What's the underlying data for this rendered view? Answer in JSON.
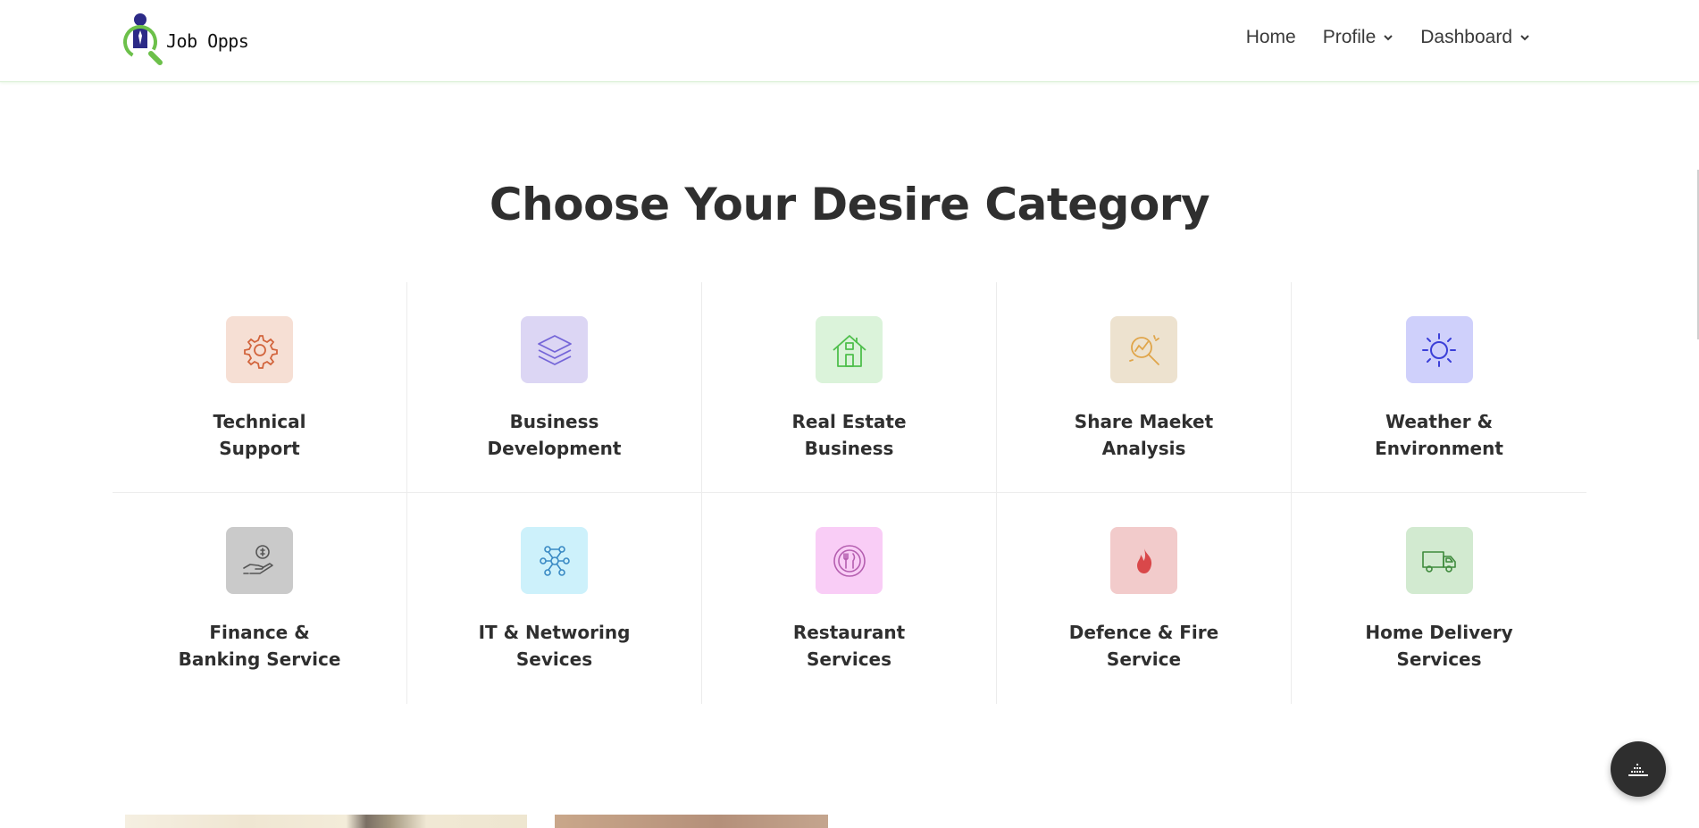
{
  "brand": {
    "name": "Job Opps"
  },
  "nav": {
    "home": "Home",
    "profile": "Profile",
    "dashboard": "Dashboard"
  },
  "section": {
    "title": "Choose Your Desire Category"
  },
  "categories": [
    {
      "line1": "Technical",
      "line2": "Support",
      "icon": "gear-icon",
      "bg": "#f6dfd4",
      "color": "#d2643c"
    },
    {
      "line1": "Business",
      "line2": "Development",
      "icon": "layers-icon",
      "bg": "#dcd6f4",
      "color": "#7566d8"
    },
    {
      "line1": "Real Estate",
      "line2": "Business",
      "icon": "house-icon",
      "bg": "#dbf3da",
      "color": "#4fbf4c"
    },
    {
      "line1": "Share Maeket",
      "line2": "Analysis",
      "icon": "magnifier-chart-icon",
      "bg": "#ede2cf",
      "color": "#e0a54a"
    },
    {
      "line1": "Weather &",
      "line2": "Environment",
      "icon": "sun-icon",
      "bg": "#cfd0fb",
      "color": "#3b3fd8"
    },
    {
      "line1": "Finance &",
      "line2": "Banking Service",
      "icon": "money-hand-icon",
      "bg": "#cacaca",
      "color": "#555555"
    },
    {
      "line1": "IT & Networing",
      "line2": "Sevices",
      "icon": "network-icon",
      "bg": "#cdf1fb",
      "color": "#3a8ac4"
    },
    {
      "line1": "Restaurant",
      "line2": "Services",
      "icon": "plate-cutlery-icon",
      "bg": "#f9cdf6",
      "color": "#b55fb0"
    },
    {
      "line1": "Defence & Fire",
      "line2": "Service",
      "icon": "fire-icon",
      "bg": "#f2cbcb",
      "color": "#d9484a"
    },
    {
      "line1": "Home Delivery",
      "line2": "Services",
      "icon": "truck-icon",
      "bg": "#d2ead0",
      "color": "#3e8a3c"
    }
  ]
}
